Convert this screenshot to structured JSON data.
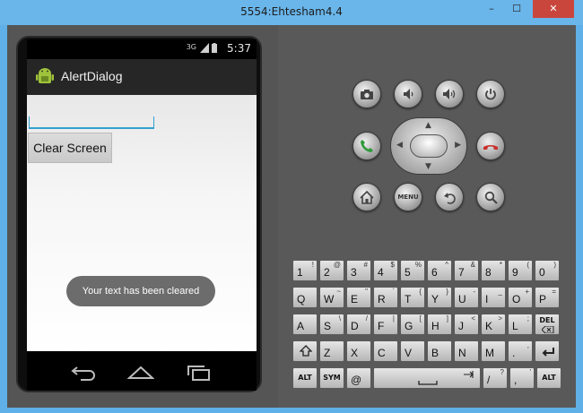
{
  "window": {
    "title": "5554:Ehtesham4.4",
    "min": "–",
    "max": "☐",
    "close": "✕"
  },
  "statusbar": {
    "time": "5:37",
    "signal": "3G"
  },
  "app": {
    "title": "AlertDialog"
  },
  "screen": {
    "edittext_value": "",
    "clear_button": "Clear Screen",
    "toast": "Your text has been cleared"
  },
  "controls": {
    "row1": [
      "camera-icon",
      "volume-down-icon",
      "volume-up-icon",
      "power-icon"
    ],
    "call": "call-icon",
    "end_call": "end-call-icon",
    "row3": [
      "home-icon",
      "MENU",
      "back-icon",
      "search-icon"
    ]
  },
  "keyboard": {
    "row1": [
      [
        "1",
        "!"
      ],
      [
        "2",
        "@"
      ],
      [
        "3",
        "#"
      ],
      [
        "4",
        "$"
      ],
      [
        "5",
        "%"
      ],
      [
        "6",
        "^"
      ],
      [
        "7",
        "&"
      ],
      [
        "8",
        "*"
      ],
      [
        "9",
        "("
      ],
      [
        "0",
        ")"
      ]
    ],
    "row2": [
      [
        "Q",
        ""
      ],
      [
        "W",
        "~"
      ],
      [
        "E",
        "\""
      ],
      [
        "R",
        "`"
      ],
      [
        "T",
        "{"
      ],
      [
        "Y",
        "}"
      ],
      [
        "U",
        "-"
      ],
      [
        "I",
        "_"
      ],
      [
        "O",
        "+"
      ],
      [
        "P",
        "="
      ]
    ],
    "row3": [
      [
        "A",
        ""
      ],
      [
        "S",
        "\\"
      ],
      [
        "D",
        "/"
      ],
      [
        "F",
        "|"
      ],
      [
        "G",
        "["
      ],
      [
        "H",
        "]"
      ],
      [
        "J",
        "<"
      ],
      [
        "K",
        ">"
      ],
      [
        "L",
        ";"
      ],
      [
        "DEL",
        ""
      ]
    ],
    "row4": [
      [
        "shift",
        ""
      ],
      [
        "Z",
        ""
      ],
      [
        "X",
        ""
      ],
      [
        "C",
        ""
      ],
      [
        "V",
        ""
      ],
      [
        "B",
        ""
      ],
      [
        "N",
        ""
      ],
      [
        "M",
        ""
      ],
      [
        ".",
        ","
      ],
      [
        "enter",
        ""
      ]
    ],
    "row5": [
      [
        "ALT",
        ""
      ],
      [
        "SYM",
        ""
      ],
      [
        "@",
        ""
      ],
      [
        "space",
        ""
      ],
      [
        "/",
        "?"
      ],
      [
        ",",
        "'"
      ],
      [
        "ALT",
        ""
      ]
    ]
  }
}
